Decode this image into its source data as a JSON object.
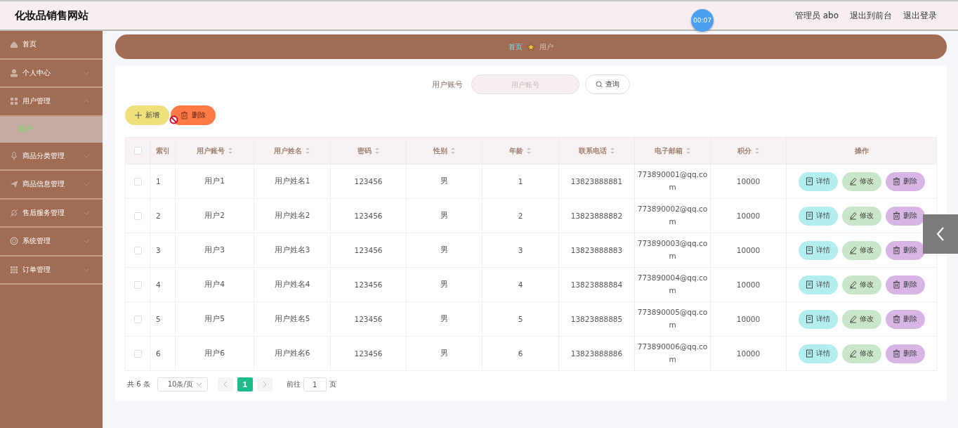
{
  "header": {
    "title": "化妆品销售网站",
    "timer": "00:07",
    "links": [
      "管理员 abo",
      "退出到前台",
      "退出登录"
    ]
  },
  "sidebar": {
    "items": [
      {
        "label": "首页",
        "selected": false
      },
      {
        "label": "个人中心",
        "expanded": false,
        "selected": false
      },
      {
        "label": "用户管理",
        "expanded": true,
        "selected": false,
        "children": [
          {
            "label": "用户",
            "selected": true
          }
        ]
      },
      {
        "label": "商品分类管理",
        "expanded": false,
        "selected": false
      },
      {
        "label": "商品信息管理",
        "expanded": false,
        "selected": false
      },
      {
        "label": "售后服务管理",
        "expanded": false,
        "selected": false
      },
      {
        "label": "系统管理",
        "expanded": false,
        "selected": false
      },
      {
        "label": "订单管理",
        "expanded": false,
        "selected": false
      }
    ]
  },
  "breadcrumb": [
    "首页",
    "用户"
  ],
  "search": {
    "label": "用户账号",
    "placeholder": "用户账号",
    "button": "查询"
  },
  "actions": [
    {
      "label": "新增",
      "kind": "add"
    },
    {
      "label": "删除",
      "kind": "delete"
    }
  ],
  "table": {
    "columns": [
      {
        "label": "索引",
        "sortable": false
      },
      {
        "label": "用户账号",
        "sortable": true
      },
      {
        "label": "用户姓名",
        "sortable": true
      },
      {
        "label": "密码",
        "sortable": true
      },
      {
        "label": "性别",
        "sortable": true
      },
      {
        "label": "年龄",
        "sortable": true
      },
      {
        "label": "联系电话",
        "sortable": true
      },
      {
        "label": "电子邮箱",
        "sortable": true
      },
      {
        "label": "积分",
        "sortable": true
      },
      {
        "label": "操作",
        "sortable": false
      }
    ],
    "header_checked": false,
    "rows": [
      {
        "checked": false,
        "cells": [
          "1",
          "用户1",
          "用户姓名1",
          "123456",
          "男",
          "1",
          "13823888881",
          "773890001@qq.com",
          "10000"
        ],
        "buttons": [
          {
            "label": "详情",
            "kind": "detail"
          },
          {
            "label": "修改",
            "kind": "edit"
          },
          {
            "label": "删除",
            "kind": "delete"
          }
        ]
      },
      {
        "checked": false,
        "cells": [
          "2",
          "用户2",
          "用户姓名2",
          "123456",
          "男",
          "2",
          "13823888882",
          "773890002@qq.com",
          "10000"
        ],
        "buttons": [
          {
            "label": "详情",
            "kind": "detail"
          },
          {
            "label": "修改",
            "kind": "edit"
          },
          {
            "label": "删除",
            "kind": "delete"
          }
        ]
      },
      {
        "checked": false,
        "cells": [
          "3",
          "用户3",
          "用户姓名3",
          "123456",
          "男",
          "3",
          "13823888883",
          "773890003@qq.com",
          "10000"
        ],
        "buttons": [
          {
            "label": "详情",
            "kind": "detail"
          },
          {
            "label": "修改",
            "kind": "edit"
          },
          {
            "label": "删除",
            "kind": "delete"
          }
        ]
      },
      {
        "checked": false,
        "cells": [
          "4",
          "用户4",
          "用户姓名4",
          "123456",
          "男",
          "4",
          "13823888884",
          "773890004@qq.com",
          "10000"
        ],
        "buttons": [
          {
            "label": "详情",
            "kind": "detail"
          },
          {
            "label": "修改",
            "kind": "edit"
          },
          {
            "label": "删除",
            "kind": "delete"
          }
        ]
      },
      {
        "checked": false,
        "cells": [
          "5",
          "用户5",
          "用户姓名5",
          "123456",
          "男",
          "5",
          "13823888885",
          "773890005@qq.com",
          "10000"
        ],
        "buttons": [
          {
            "label": "详情",
            "kind": "detail"
          },
          {
            "label": "修改",
            "kind": "edit"
          },
          {
            "label": "删除",
            "kind": "delete"
          }
        ]
      },
      {
        "checked": false,
        "cells": [
          "6",
          "用户6",
          "用户姓名6",
          "123456",
          "男",
          "6",
          "13823888886",
          "773890006@qq.com",
          "10000"
        ],
        "buttons": [
          {
            "label": "详情",
            "kind": "detail"
          },
          {
            "label": "修改",
            "kind": "edit"
          },
          {
            "label": "删除",
            "kind": "delete"
          }
        ]
      }
    ]
  },
  "pagination": {
    "total": "共 6 条",
    "page_size": "10条/页",
    "pages": [
      {
        "label": "1",
        "selected": true
      }
    ],
    "goto_label": "前往",
    "goto_value": "1",
    "goto_suffix": "页"
  }
}
